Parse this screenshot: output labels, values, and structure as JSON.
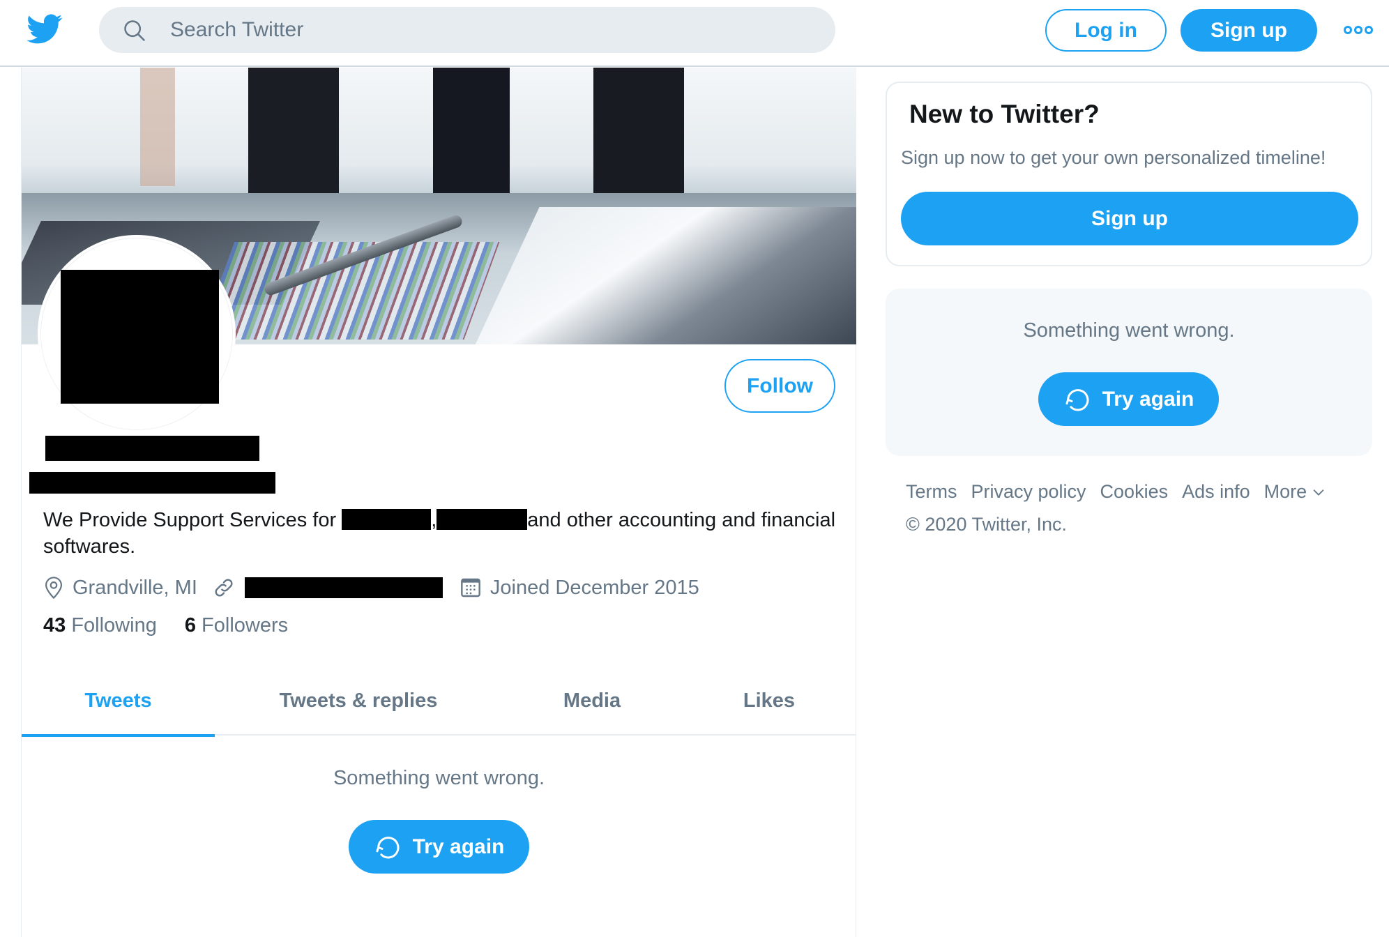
{
  "header": {
    "logo": "twitter-bird-icon",
    "search_placeholder": "Search Twitter",
    "login_label": "Log in",
    "signup_label": "Sign up",
    "more_icon": "more-dots-icon"
  },
  "profile": {
    "name": "[redacted]",
    "handle": "[redacted]",
    "follow_label": "Follow",
    "bio_part1": "We Provide Support Services for ",
    "bio_sep": ",",
    "bio_part2": "and other accounting and financial softwares.",
    "location": "Grandville, MI",
    "website": "[redacted]",
    "joined": "Joined December 2015",
    "following_count": "43",
    "following_label": "Following",
    "followers_count": "6",
    "followers_label": "Followers"
  },
  "tabs": [
    {
      "label": "Tweets",
      "active": true
    },
    {
      "label": "Tweets & replies",
      "active": false
    },
    {
      "label": "Media",
      "active": false
    },
    {
      "label": "Likes",
      "active": false
    }
  ],
  "timeline": {
    "error_message": "Something went wrong.",
    "retry_label": "Try again"
  },
  "sidebar": {
    "new_card": {
      "title": "New to Twitter?",
      "subtitle": "Sign up now to get your own personalized timeline!",
      "signup_label": "Sign up"
    },
    "error_card": {
      "error_message": "Something went wrong.",
      "retry_label": "Try again"
    },
    "footer_links": [
      "Terms",
      "Privacy policy",
      "Cookies",
      "Ads info",
      "More"
    ],
    "copyright": "© 2020 Twitter, Inc."
  },
  "colors": {
    "accent": "#1DA1F2",
    "secondary_text": "#657786",
    "primary_text": "#14171A",
    "border": "#E6ECF0",
    "card_bg": "#F5F8FA"
  }
}
